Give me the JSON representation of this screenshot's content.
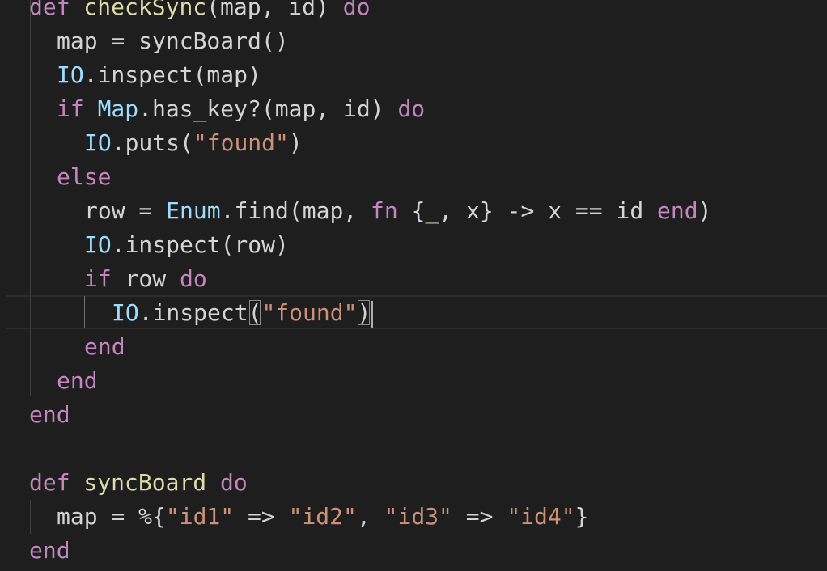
{
  "editor": {
    "language": "elixir",
    "colors": {
      "background": "#1e1e1e",
      "keyword": "#c586c0",
      "function": "#dcdcaa",
      "module": "#9cdcfe",
      "string": "#ce9178",
      "text": "#d4d4d4"
    }
  },
  "code": {
    "l1": {
      "t1": "def",
      "t2": " checkSync",
      "t3": "(map, id) ",
      "t4": "do"
    },
    "l2": {
      "t1": "map = syncBoard()"
    },
    "l3": {
      "t1": "IO",
      "t2": ".inspect(map)"
    },
    "l4": {
      "t1": "if",
      "t2": " ",
      "t3": "Map",
      "t4": ".has_key?(map, id) ",
      "t5": "do"
    },
    "l5": {
      "t1": "IO",
      "t2": ".puts(",
      "t3": "\"found\"",
      "t4": ")"
    },
    "l6": {
      "t1": "else"
    },
    "l7": {
      "t1": "row = ",
      "t2": "Enum",
      "t3": ".find(map, ",
      "t4": "fn",
      "t5": " {",
      "t6": "_",
      "t7": ", x} -> x == id ",
      "t8": "end",
      "t9": ")"
    },
    "l8": {
      "t1": "IO",
      "t2": ".inspect(row)"
    },
    "l9": {
      "t1": "if",
      "t2": " row ",
      "t3": "do"
    },
    "l10": {
      "t1": "IO",
      "t2": ".inspect",
      "t3": "(",
      "t4": "\"found\"",
      "t5": ")"
    },
    "l11": {
      "t1": "end"
    },
    "l12": {
      "t1": "end"
    },
    "l13": {
      "t1": "end"
    },
    "l15": {
      "t1": "def",
      "t2": " syncBoard ",
      "t3": "do"
    },
    "l16": {
      "t1": "map = %{",
      "t2": "\"id1\"",
      "t3": " => ",
      "t4": "\"id2\"",
      "t5": ", ",
      "t6": "\"id3\"",
      "t7": " => ",
      "t8": "\"id4\"",
      "t9": "}"
    },
    "l17": {
      "t1": "end"
    }
  }
}
